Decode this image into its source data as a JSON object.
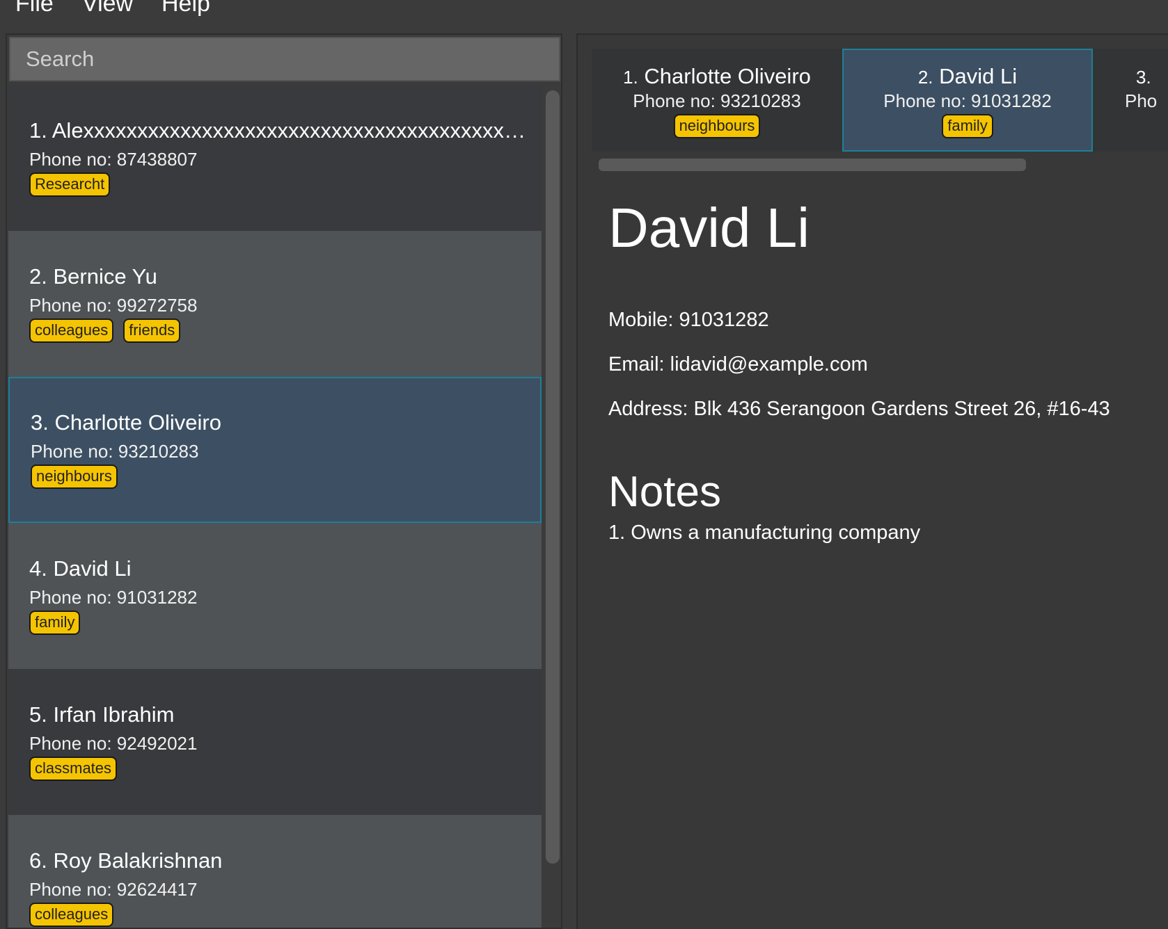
{
  "menu": {
    "file": "File",
    "view": "View",
    "help": "Help"
  },
  "search": {
    "placeholder": "Search"
  },
  "contacts": [
    {
      "name": "1. Alexxxxxxxxxxxxxxxxxxxxxxxxxxxxxxxxxxxxxxxxxxxxxxxxxxx...",
      "phone": "Phone no: 87438807",
      "tags": [
        "Researcht"
      ]
    },
    {
      "name": "2. Bernice Yu",
      "phone": "Phone no: 99272758",
      "tags": [
        "colleagues",
        "friends"
      ]
    },
    {
      "name": "3. Charlotte Oliveiro",
      "phone": "Phone no: 93210283",
      "tags": [
        "neighbours"
      ]
    },
    {
      "name": "4. David Li",
      "phone": "Phone no: 91031282",
      "tags": [
        "family"
      ]
    },
    {
      "name": "5. Irfan Ibrahim",
      "phone": "Phone no: 92492021",
      "tags": [
        "classmates"
      ]
    },
    {
      "name": "6. Roy Balakrishnan",
      "phone": "Phone no: 92624417",
      "tags": [
        "colleagues"
      ]
    }
  ],
  "pinned_tabs": [
    {
      "num": "1.",
      "name": "Charlotte Oliveiro",
      "phone": "Phone no: 93210283",
      "tag": "neighbours"
    },
    {
      "num": "2.",
      "name": "David Li",
      "phone": "Phone no: 91031282",
      "tag": "family"
    },
    {
      "num": "3.",
      "name": "",
      "phone": "Pho",
      "tag": ""
    }
  ],
  "detail": {
    "name": "David Li",
    "mobile": "Mobile: 91031282",
    "email": "Email: lidavid@example.com",
    "address": "Address: Blk 436 Serangoon Gardens Street 26, #16-43",
    "notes_title": "Notes",
    "notes": [
      "1. Owns a manufacturing company"
    ]
  },
  "colors": {
    "tag": "#f5c400",
    "selected": "#3d5063",
    "selected_border": "#1e7f99",
    "background": "#3b3b3b"
  }
}
